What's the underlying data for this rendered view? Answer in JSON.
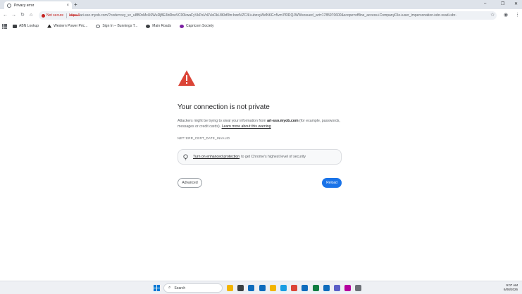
{
  "tab": {
    "title": "Privacy error",
    "close": "×",
    "new_tab": "+"
  },
  "window": {
    "minimize": "–",
    "restore": "❐",
    "close": "✕"
  },
  "toolbar": {
    "back": "←",
    "forward": "→",
    "reload": "↻",
    "home": "⌂",
    "not_secure": "Not secure",
    "url_scheme": "https://",
    "url_rest": "ari-sso.myob.com/?code=cey_xc_u8B0vMxU6WuRjBE4b0bwVC00kwaFyVkPaVdJVaOkL8Kbf0trr.bwdVZC4I+ubzxyWdNKG=5vm7fRRQJWWsosuecl_art=1785970600&scope=offline_access+CompanyFile+user_impersonation+sbr-read+sbr-",
    "star": "☆",
    "profile": "◉",
    "menu": "⋮"
  },
  "bookmarks": [
    {
      "label": "ABN Lookup",
      "color": "#3c4043"
    },
    {
      "label": "Western Power Pric...",
      "color": "#1f1f1f"
    },
    {
      "label": "Sign In – Bunnings T...",
      "color": "#5f6368"
    },
    {
      "label": "Main Roads",
      "color": "#3c4043"
    },
    {
      "label": "Capricorn Society",
      "color": "#7b1fa2"
    }
  ],
  "page": {
    "heading": "Your connection is not private",
    "desc_pre": "Attackers might be trying to steal your information from ",
    "desc_host": "ari-sso.myob.com",
    "desc_post": " (for example, passwords, messages or credit cards). ",
    "learn_more": "Learn more about this warning",
    "error_code": "NET::ERR_CERT_DATE_INVALID",
    "enhanced_link": "Turn on enhanced protection",
    "enhanced_tail": "to get Chrome's highest level of security",
    "advanced": "Advanced",
    "reload": "Reload"
  },
  "taskbar": {
    "search": "Search",
    "time": "9:07 AM",
    "date": "6/08/2026",
    "apps": [
      {
        "name": "file-explorer-icon",
        "color": "#f2b400"
      },
      {
        "name": "task-view-icon",
        "color": "#3c4043"
      },
      {
        "name": "outlook-icon",
        "color": "#0f6cbd"
      },
      {
        "name": "store-icon",
        "color": "#0f6cbd"
      },
      {
        "name": "folder-icon",
        "color": "#f2b400"
      },
      {
        "name": "edge-icon",
        "color": "#1b9de2"
      },
      {
        "name": "chrome-icon",
        "color": "#db4437"
      },
      {
        "name": "mail-icon",
        "color": "#0f6cbd"
      },
      {
        "name": "excel-icon",
        "color": "#107c41"
      },
      {
        "name": "outlook-new-icon",
        "color": "#0f6cbd"
      },
      {
        "name": "teams-icon",
        "color": "#5b5fc7"
      },
      {
        "name": "avatar-app-icon",
        "color": "#b4009e"
      },
      {
        "name": "phone-icon",
        "color": "#6b6f76"
      }
    ]
  },
  "colors": {
    "accent": "#1a73e8",
    "danger": "#db4437"
  }
}
